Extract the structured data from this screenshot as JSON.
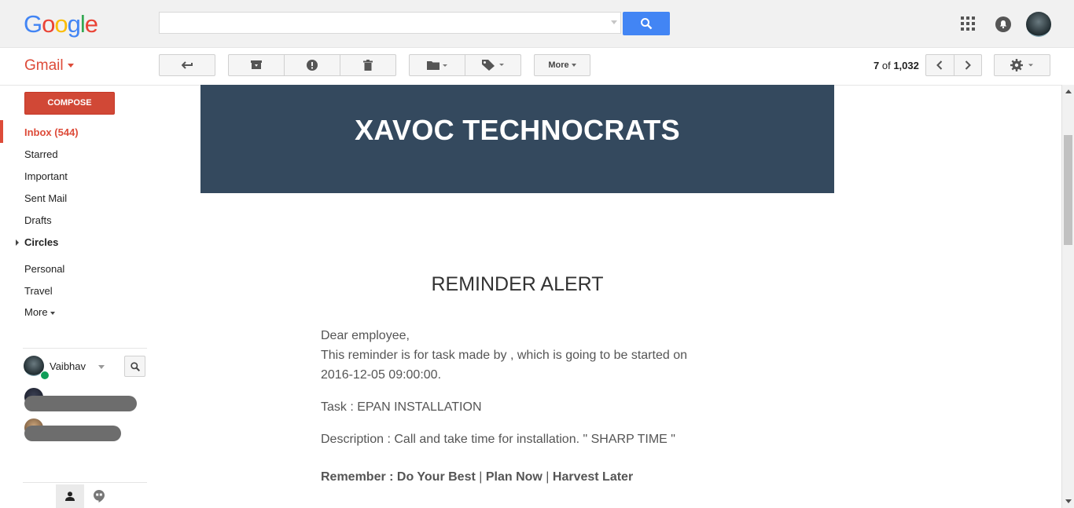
{
  "topbar": {
    "logo": [
      "G",
      "o",
      "o",
      "g",
      "l",
      "e"
    ],
    "logo_colors": [
      "#4285f4",
      "#ea4335",
      "#fbbc05",
      "#4285f4",
      "#34a853",
      "#ea4335"
    ],
    "search": {
      "value": "",
      "placeholder": ""
    }
  },
  "subbar": {
    "app_label": "Gmail",
    "more_label": "More",
    "pager": {
      "current": "7",
      "of": "of",
      "total": "1,032"
    }
  },
  "sidebar": {
    "compose": "COMPOSE",
    "items": [
      {
        "label": "Inbox (544)"
      },
      {
        "label": "Starred"
      },
      {
        "label": "Important"
      },
      {
        "label": "Sent Mail"
      },
      {
        "label": "Drafts"
      },
      {
        "label": "Circles"
      },
      {
        "label": "Personal"
      },
      {
        "label": "Travel"
      },
      {
        "label": "More"
      }
    ],
    "hangouts": {
      "user": "Vaibhav"
    }
  },
  "email": {
    "company": "XAVOC TECHNOCRATS",
    "title": "REMINDER ALERT",
    "greeting": "Dear employee,",
    "line1": "This reminder is for task made by , which is going to be started on",
    "line2": "2016-12-05 09:00:00.",
    "task": "Task : EPAN INSTALLATION",
    "description": "Description : Call and take time for installation. \" SHARP TIME \"",
    "remember_prefix": "Remember : ",
    "remember_1": "Do Your Best",
    "sep": " | ",
    "remember_2": "Plan Now",
    "remember_3": "Harvest Later"
  },
  "colors": {
    "accent": "#dd4b39",
    "banner": "#34495e",
    "search_button": "#4285f4",
    "online": "#0f9d58"
  }
}
